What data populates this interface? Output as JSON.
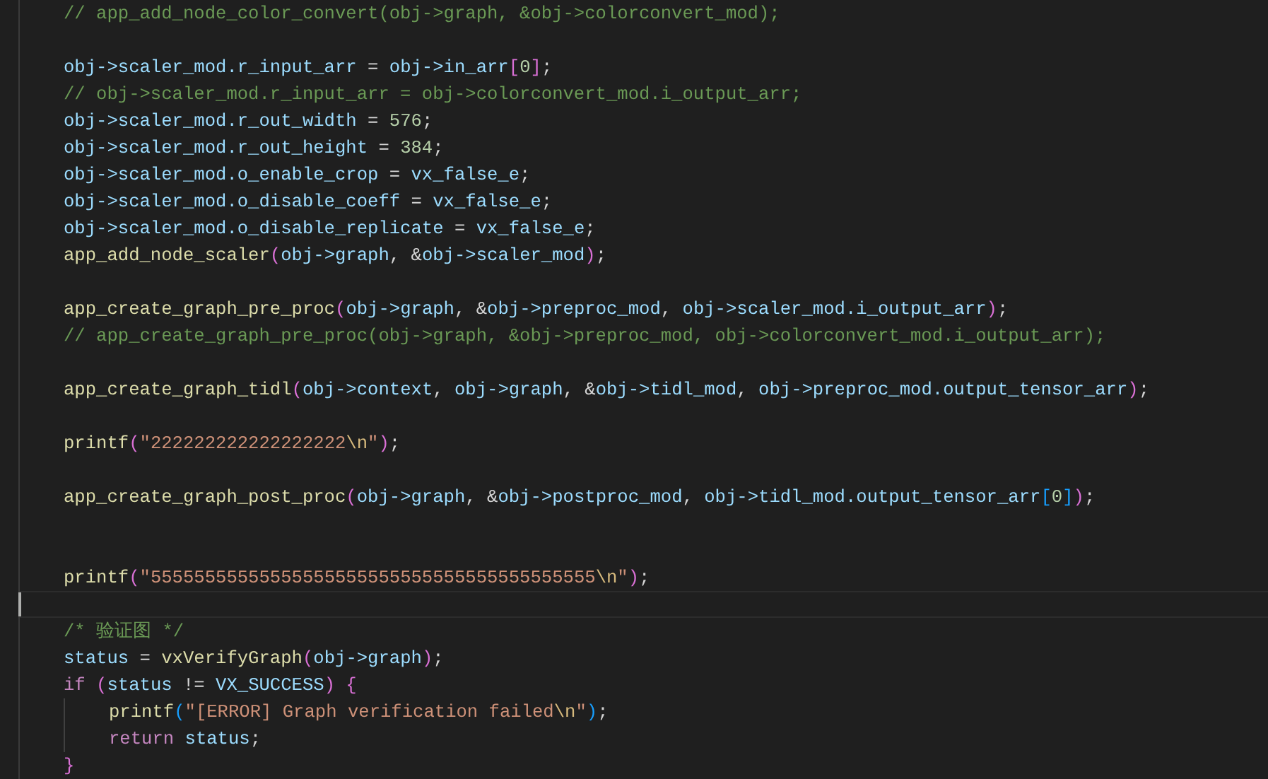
{
  "editor": {
    "lines": [
      {
        "kind": "code",
        "tokens": [
          {
            "text": "// app_add_node_color_convert(obj->graph, &obj->colorconvert_mod);",
            "kind": "comment"
          }
        ]
      },
      {
        "kind": "blank"
      },
      {
        "kind": "code",
        "tokens": [
          {
            "text": "obj->scaler_mod.r_input_arr",
            "kind": "variable"
          },
          {
            "text": " = ",
            "kind": "plain"
          },
          {
            "text": "obj->in_arr",
            "kind": "variable"
          },
          {
            "text": "[",
            "kind": "bracket1"
          },
          {
            "text": "0",
            "kind": "number"
          },
          {
            "text": "]",
            "kind": "bracket1"
          },
          {
            "text": ";",
            "kind": "plain"
          }
        ]
      },
      {
        "kind": "code",
        "tokens": [
          {
            "text": "// obj->scaler_mod.r_input_arr = obj->colorconvert_mod.i_output_arr;",
            "kind": "comment"
          }
        ]
      },
      {
        "kind": "code",
        "tokens": [
          {
            "text": "obj->scaler_mod.r_out_width",
            "kind": "variable"
          },
          {
            "text": " = ",
            "kind": "plain"
          },
          {
            "text": "576",
            "kind": "number"
          },
          {
            "text": ";",
            "kind": "plain"
          }
        ]
      },
      {
        "kind": "code",
        "tokens": [
          {
            "text": "obj->scaler_mod.r_out_height",
            "kind": "variable"
          },
          {
            "text": " = ",
            "kind": "plain"
          },
          {
            "text": "384",
            "kind": "number"
          },
          {
            "text": ";",
            "kind": "plain"
          }
        ]
      },
      {
        "kind": "code",
        "tokens": [
          {
            "text": "obj->scaler_mod.o_enable_crop",
            "kind": "variable"
          },
          {
            "text": " = ",
            "kind": "plain"
          },
          {
            "text": "vx_false_e",
            "kind": "variable"
          },
          {
            "text": ";",
            "kind": "plain"
          }
        ]
      },
      {
        "kind": "code",
        "tokens": [
          {
            "text": "obj->scaler_mod.o_disable_coeff",
            "kind": "variable"
          },
          {
            "text": " = ",
            "kind": "plain"
          },
          {
            "text": "vx_false_e",
            "kind": "variable"
          },
          {
            "text": ";",
            "kind": "plain"
          }
        ]
      },
      {
        "kind": "code",
        "tokens": [
          {
            "text": "obj->scaler_mod.o_disable_replicate",
            "kind": "variable"
          },
          {
            "text": " = ",
            "kind": "plain"
          },
          {
            "text": "vx_false_e",
            "kind": "variable"
          },
          {
            "text": ";",
            "kind": "plain"
          }
        ]
      },
      {
        "kind": "code",
        "tokens": [
          {
            "text": "app_add_node_scaler",
            "kind": "function"
          },
          {
            "text": "(",
            "kind": "bracket1"
          },
          {
            "text": "obj->graph",
            "kind": "variable"
          },
          {
            "text": ", &",
            "kind": "plain"
          },
          {
            "text": "obj->scaler_mod",
            "kind": "variable"
          },
          {
            "text": ")",
            "kind": "bracket1"
          },
          {
            "text": ";",
            "kind": "plain"
          }
        ]
      },
      {
        "kind": "blank"
      },
      {
        "kind": "code",
        "tokens": [
          {
            "text": "app_create_graph_pre_proc",
            "kind": "function"
          },
          {
            "text": "(",
            "kind": "bracket1"
          },
          {
            "text": "obj->graph",
            "kind": "variable"
          },
          {
            "text": ", &",
            "kind": "plain"
          },
          {
            "text": "obj->preproc_mod",
            "kind": "variable"
          },
          {
            "text": ", ",
            "kind": "plain"
          },
          {
            "text": "obj->scaler_mod.i_output_arr",
            "kind": "variable"
          },
          {
            "text": ")",
            "kind": "bracket1"
          },
          {
            "text": ";",
            "kind": "plain"
          }
        ]
      },
      {
        "kind": "code",
        "tokens": [
          {
            "text": "// app_create_graph_pre_proc(obj->graph, &obj->preproc_mod, obj->colorconvert_mod.i_output_arr);",
            "kind": "comment"
          }
        ]
      },
      {
        "kind": "blank"
      },
      {
        "kind": "code",
        "tokens": [
          {
            "text": "app_create_graph_tidl",
            "kind": "function"
          },
          {
            "text": "(",
            "kind": "bracket1"
          },
          {
            "text": "obj->context",
            "kind": "variable"
          },
          {
            "text": ", ",
            "kind": "plain"
          },
          {
            "text": "obj->graph",
            "kind": "variable"
          },
          {
            "text": ", &",
            "kind": "plain"
          },
          {
            "text": "obj->tidl_mod",
            "kind": "variable"
          },
          {
            "text": ", ",
            "kind": "plain"
          },
          {
            "text": "obj->preproc_mod.output_tensor_arr",
            "kind": "variable"
          },
          {
            "text": ")",
            "kind": "bracket1"
          },
          {
            "text": ";",
            "kind": "plain"
          }
        ]
      },
      {
        "kind": "blank"
      },
      {
        "kind": "code",
        "tokens": [
          {
            "text": "printf",
            "kind": "function"
          },
          {
            "text": "(",
            "kind": "bracket1"
          },
          {
            "text": "\"222222222222222222",
            "kind": "string"
          },
          {
            "text": "\\n",
            "kind": "escape"
          },
          {
            "text": "\"",
            "kind": "string"
          },
          {
            "text": ")",
            "kind": "bracket1"
          },
          {
            "text": ";",
            "kind": "plain"
          }
        ]
      },
      {
        "kind": "blank"
      },
      {
        "kind": "code",
        "tokens": [
          {
            "text": "app_create_graph_post_proc",
            "kind": "function"
          },
          {
            "text": "(",
            "kind": "bracket1"
          },
          {
            "text": "obj->graph",
            "kind": "variable"
          },
          {
            "text": ", &",
            "kind": "plain"
          },
          {
            "text": "obj->postproc_mod",
            "kind": "variable"
          },
          {
            "text": ", ",
            "kind": "plain"
          },
          {
            "text": "obj->tidl_mod.output_tensor_arr",
            "kind": "variable"
          },
          {
            "text": "[",
            "kind": "bracket2"
          },
          {
            "text": "0",
            "kind": "number"
          },
          {
            "text": "]",
            "kind": "bracket2"
          },
          {
            "text": ")",
            "kind": "bracket1"
          },
          {
            "text": ";",
            "kind": "plain"
          }
        ]
      },
      {
        "kind": "blank"
      },
      {
        "kind": "blank"
      },
      {
        "kind": "code",
        "tokens": [
          {
            "text": "printf",
            "kind": "function"
          },
          {
            "text": "(",
            "kind": "bracket1"
          },
          {
            "text": "\"55555555555555555555555555555555555555555",
            "kind": "string"
          },
          {
            "text": "\\n",
            "kind": "escape"
          },
          {
            "text": "\"",
            "kind": "string"
          },
          {
            "text": ")",
            "kind": "bracket1"
          },
          {
            "text": ";",
            "kind": "plain"
          }
        ]
      },
      {
        "kind": "blank",
        "current": true
      },
      {
        "kind": "code",
        "tokens": [
          {
            "text": "/* 验证图 */",
            "kind": "comment"
          }
        ]
      },
      {
        "kind": "code",
        "tokens": [
          {
            "text": "status",
            "kind": "variable"
          },
          {
            "text": " = ",
            "kind": "plain"
          },
          {
            "text": "vxVerifyGraph",
            "kind": "function"
          },
          {
            "text": "(",
            "kind": "bracket1"
          },
          {
            "text": "obj->graph",
            "kind": "variable"
          },
          {
            "text": ")",
            "kind": "bracket1"
          },
          {
            "text": ";",
            "kind": "plain"
          }
        ]
      },
      {
        "kind": "code",
        "tokens": [
          {
            "text": "if ",
            "kind": "keyword"
          },
          {
            "text": "(",
            "kind": "bracket1"
          },
          {
            "text": "status",
            "kind": "variable"
          },
          {
            "text": " != ",
            "kind": "plain"
          },
          {
            "text": "VX_SUCCESS",
            "kind": "variable"
          },
          {
            "text": ") {",
            "kind": "bracket1"
          }
        ],
        "children": [
          {
            "kind": "code",
            "tokens": [
              {
                "text": "printf",
                "kind": "function"
              },
              {
                "text": "(",
                "kind": "bracket2"
              },
              {
                "text": "\"[ERROR] Graph verification failed",
                "kind": "string"
              },
              {
                "text": "\\n",
                "kind": "escape"
              },
              {
                "text": "\"",
                "kind": "string"
              },
              {
                "text": ")",
                "kind": "bracket2"
              },
              {
                "text": ";",
                "kind": "plain"
              }
            ]
          },
          {
            "kind": "code",
            "tokens": [
              {
                "text": "return ",
                "kind": "keyword"
              },
              {
                "text": "status",
                "kind": "variable"
              },
              {
                "text": ";",
                "kind": "plain"
              }
            ]
          }
        ]
      },
      {
        "kind": "code",
        "tokens": [
          {
            "text": "}",
            "kind": "bracket1"
          }
        ]
      }
    ]
  }
}
